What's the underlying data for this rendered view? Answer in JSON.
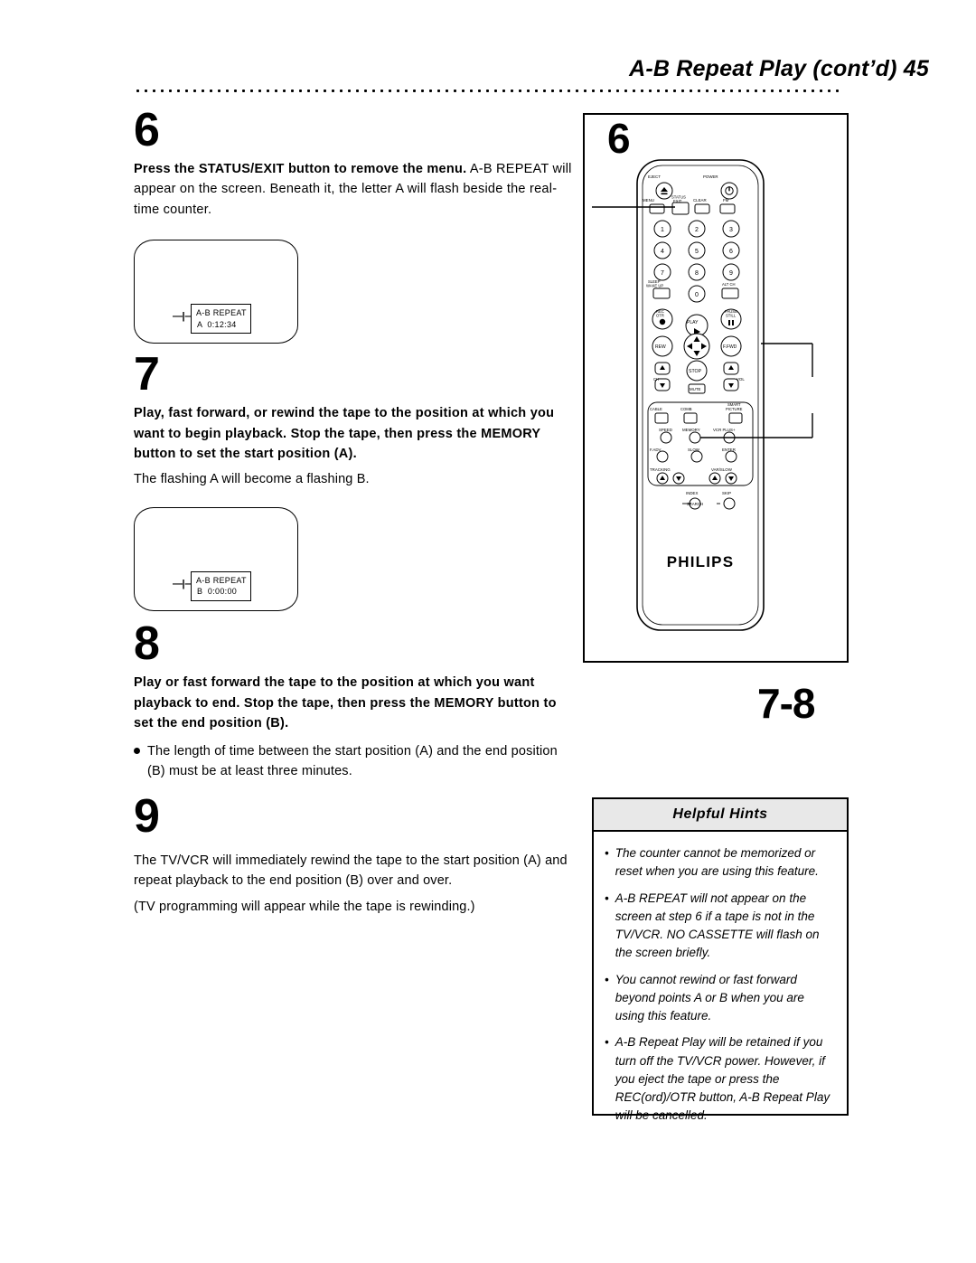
{
  "header": {
    "title": "A-B Repeat Play (cont’d)",
    "page_number": "45"
  },
  "steps": [
    {
      "number": "6",
      "bold_text": "Press the STATUS/EXIT button to remove the menu.",
      "body_text": " A-B REPEAT will appear on the screen. Beneath it, the letter A will flash beside the real-time counter.",
      "screen": {
        "line1": "A-B REPEAT",
        "line2": "0:12:34",
        "flash_letter": "A"
      }
    },
    {
      "number": "7",
      "bold_text": "Play, fast forward, or rewind the tape to the position at which you want to begin playback. Stop the tape, then press the MEMORY button to set the start position (A).",
      "body_text": "The flashing A will become a flashing B.",
      "screen": {
        "line1": "A-B REPEAT",
        "line2": "0:00:00",
        "flash_letter": "B"
      }
    },
    {
      "number": "8",
      "bold_text": "Play or fast forward the tape to the position at which you want playback to end. Stop the tape, then press the MEMORY button to set the end position (B).",
      "bullet_text": "The length of time between the start position (A) and the end position (B) must be at least three minutes."
    },
    {
      "number": "9",
      "body_text": "The TV/VCR will immediately rewind the tape to the start position (A) and repeat playback to the end position (B) over and over.",
      "note_text": "(TV programming will appear while the tape is rewinding.)"
    }
  ],
  "callouts": {
    "remote_top": "6",
    "remote_bottom": "7-8"
  },
  "remote": {
    "brand": "PHILIPS",
    "labels": {
      "eject": "EJECT",
      "power": "POWER",
      "menu": "MENU",
      "status_exit": "STATUS\nEXIT",
      "clear": "CLEAR",
      "fm": "FM",
      "sleep_wakeup": "SLEEP\nWAKE UP",
      "alt_ch": "ALT CH",
      "rec_otr": "REC\nOTR",
      "play": "PLAY",
      "pause_still": "PAUSE\nSTILL",
      "rew": "REW",
      "ffwd": "F.FWD",
      "stop": "STOP",
      "ch": "CH",
      "mute": "MUTE",
      "vol": "VOL",
      "cable": "CABLE",
      "comb": "COMB",
      "smart_picture": "SMART\nPICTURE",
      "speed": "SPEED",
      "memory": "MEMORY",
      "vcr_plus": "VCR PLUS+",
      "f_adv": "F.ADV",
      "slow": "SLOW",
      "enter": "ENTER",
      "tracking": "TRACKING",
      "var_slow": "VAR/SLOW",
      "index": "INDEX",
      "skip": "SKIP",
      "search": "SEARCH"
    },
    "keypad": [
      "1",
      "2",
      "3",
      "4",
      "5",
      "6",
      "7",
      "8",
      "9",
      "0"
    ]
  },
  "hints": {
    "title": "Helpful Hints",
    "bullet": "•",
    "items": [
      "The counter cannot be memorized or reset when you are using this feature.",
      "A-B REPEAT will not appear on the screen at step 6 if a tape is not in the TV/VCR. NO CASSETTE will flash on the screen briefly.",
      "You cannot rewind or fast forward beyond points A or B when you are using this feature.",
      "A-B Repeat Play will be retained if you turn off the TV/VCR power. However, if you eject the tape or press the REC(ord)/OTR button, A-B Repeat Play will be cancelled."
    ]
  }
}
